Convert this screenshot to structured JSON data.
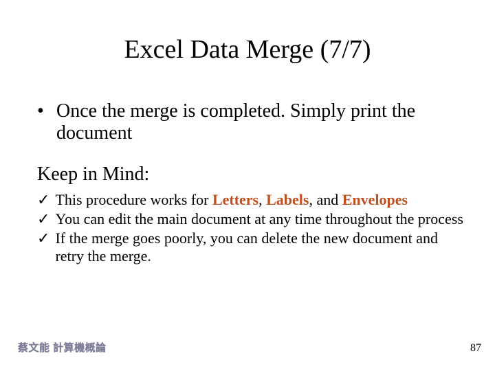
{
  "title": "Excel Data Merge (7/7)",
  "bullet1": "Once the merge is completed.  Simply print the document",
  "heading2": "Keep in Mind:",
  "check1_prefix": "This procedure works for ",
  "check1_letters": "Letters",
  "check1_sep1": ", ",
  "check1_labels": "Labels",
  "check1_sep2": ", and ",
  "check1_envelopes": "Envelopes",
  "check2": "You can edit the main document at any time throughout the process",
  "check3": "If the merge goes poorly, you can delete the new document and retry the merge.",
  "footer_left": "蔡文能 計算機概論",
  "page_number": "87",
  "glyphs": {
    "bullet": "•",
    "check": "✓"
  }
}
